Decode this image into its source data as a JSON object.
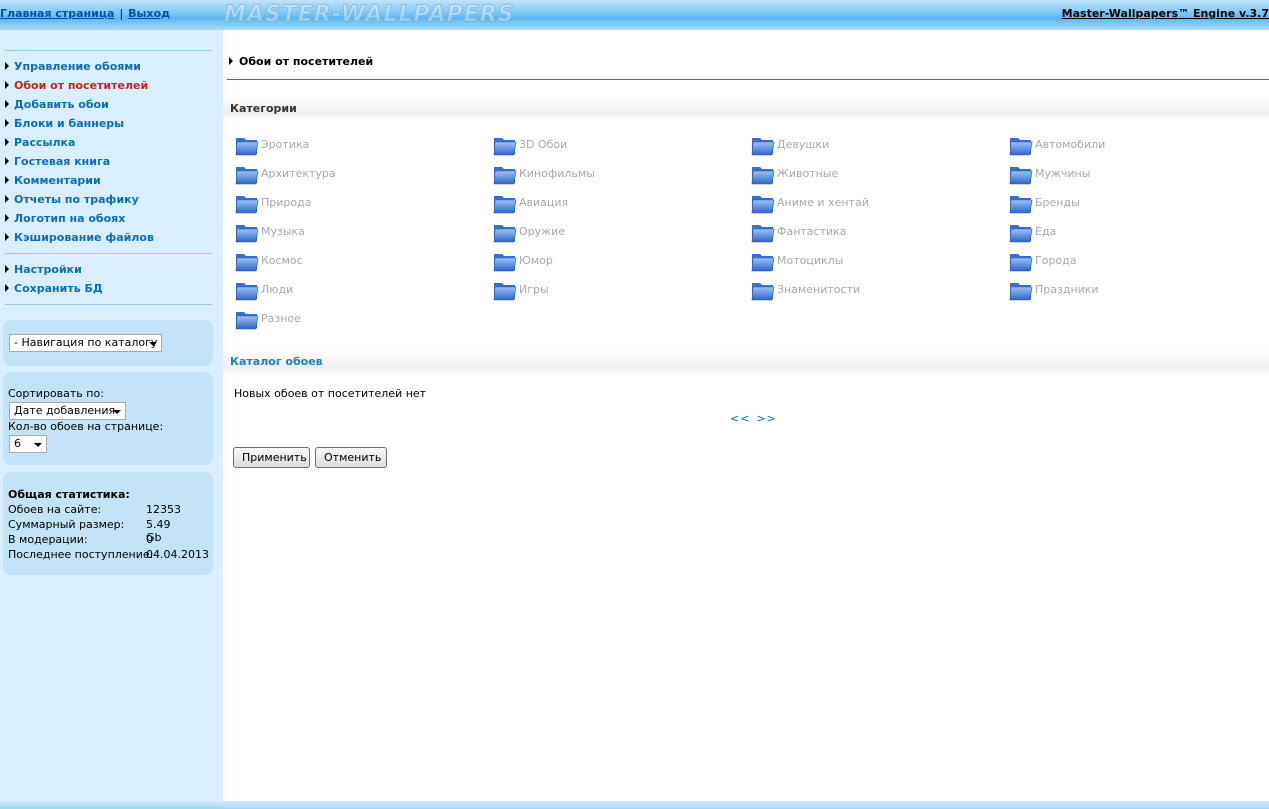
{
  "header": {
    "home_link": "Главная страница",
    "separator": "|",
    "logout_link": "Выход",
    "watermark": "MASTER-WALLPAPERS",
    "brand": "Master-Wallpapers™ Engine v.3.7"
  },
  "sidebar": {
    "menu_main": [
      "Управление обоями",
      "Обои от посетителей",
      "Добавить обои",
      "Блоки и баннеры",
      "Рассылка",
      "Гостевая книга",
      "Комментарии",
      "Отчеты по трафику",
      "Логотип на обоях",
      "Кэширование файлов"
    ],
    "active_item": "Обои от посетителей",
    "menu_settings": [
      "Настройки",
      "Сохранить БД"
    ],
    "nav_select": "- Навигация по каталогу",
    "sort_label": "Сортировать по:",
    "sort_value": "Дате добавления",
    "per_page_label": "Кол-во обоев на странице:",
    "per_page_value": "6",
    "stats": {
      "title": "Общая статистика:",
      "rows": [
        {
          "label": "Обоев на сайте:",
          "value": "12353"
        },
        {
          "label": "Суммарный размер:",
          "value": "5.49 Gb"
        },
        {
          "label": "В модерации:",
          "value": "0"
        },
        {
          "label": "Последнее поступление:",
          "value": "04.04.2013"
        }
      ]
    }
  },
  "main": {
    "breadcrumb": "Обои от посетителей",
    "categories_title": "Категории",
    "categories": [
      "Эротика",
      "3D Обои",
      "Девушки",
      "Автомобили",
      "Архитектура",
      "Кинофильмы",
      "Животные",
      "Мужчины",
      "Природа",
      "Авиация",
      "Аниме и хентай",
      "Бренды",
      "Музыка",
      "Оружие",
      "Фантастика",
      "Еда",
      "Космос",
      "Юмор",
      "Мотоциклы",
      "Города",
      "Люди",
      "Игры",
      "Знаменитости",
      "Праздники",
      "Разное"
    ],
    "catalog_title": "Каталог обоев",
    "empty_message": "Новых обоев от посетителей нет",
    "pager_prev": "<<",
    "pager_next": ">>",
    "apply_button": "Применить",
    "cancel_button": "Отменить"
  },
  "colors": {
    "link": "#0a6fb3",
    "active": "#c0281b",
    "sidebar_bg": "#d9efff",
    "category_text": "#a9a9a9",
    "section_title_blue": "#1f7fc7"
  }
}
